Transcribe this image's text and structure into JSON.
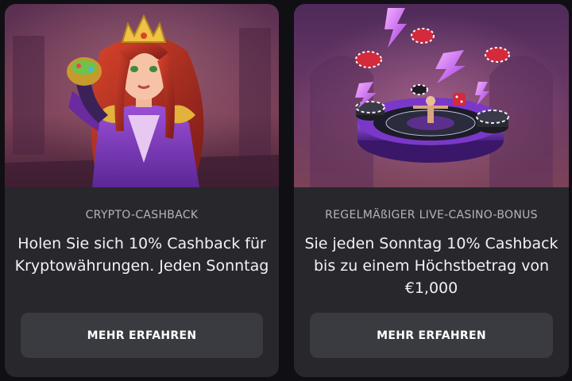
{
  "cards": [
    {
      "label": "CRYPTO-CASHBACK",
      "description": "Holen Sie sich 10% Cashback für Kryptowährungen. Jeden Sonntag",
      "button_label": "MEHR ERFAHREN",
      "image_icon": "queen-character-illustration"
    },
    {
      "label": "REGELMÄßIGER LIVE-CASINO-BONUS",
      "description": "Sie jeden Sonntag 10% Cashback bis zu einem Höchstbetrag von €1,000",
      "button_label": "MEHR ERFAHREN",
      "image_icon": "roulette-wheel-illustration"
    }
  ],
  "colors": {
    "page_background": "#101014",
    "card_background": "#27272c",
    "button_background": "#3a3a41",
    "label_text": "#b4b4bc",
    "body_text": "#f2f2f5",
    "accent_purple": "#7a2fc4"
  }
}
